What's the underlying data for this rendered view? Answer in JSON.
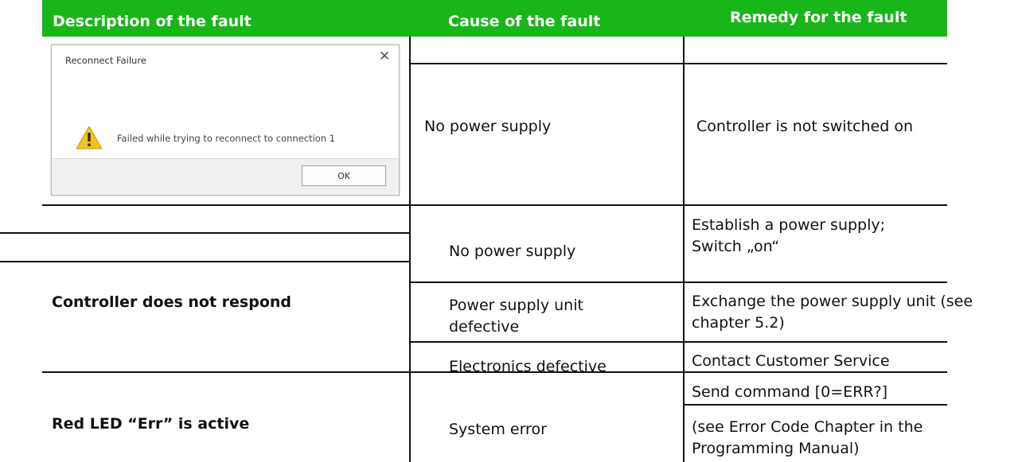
{
  "header": {
    "description": "Description of the fault",
    "cause": "Cause of the fault",
    "remedy": "Remedy for the fault"
  },
  "dialog": {
    "title": "Reconnect Failure",
    "close_glyph": "✕",
    "message": "Failed while trying to reconnect to connection 1",
    "ok_label": "OK",
    "icon": "warning-icon"
  },
  "rows": {
    "reconnect": {
      "cause": "No power supply",
      "remedy": "Controller is not switched on"
    },
    "controller": {
      "description": "Controller does not respond",
      "causes": [
        "No power supply",
        "Power supply unit",
        "defective",
        "Electronics defective"
      ],
      "remedies": [
        "Establish a power supply;",
        "Switch „on“",
        "Exchange the power supply unit (see",
        "chapter 5.2)",
        "Contact Customer Service"
      ]
    },
    "red_led": {
      "description": "Red LED “Err” is active",
      "cause": "System error",
      "remedies": [
        "Send command [0=ERR?]",
        "(see Error Code Chapter in the",
        "Programming Manual)"
      ]
    }
  },
  "colors": {
    "header_bg": "#18b618",
    "header_text": "#ffffff",
    "rule": "#111111"
  }
}
